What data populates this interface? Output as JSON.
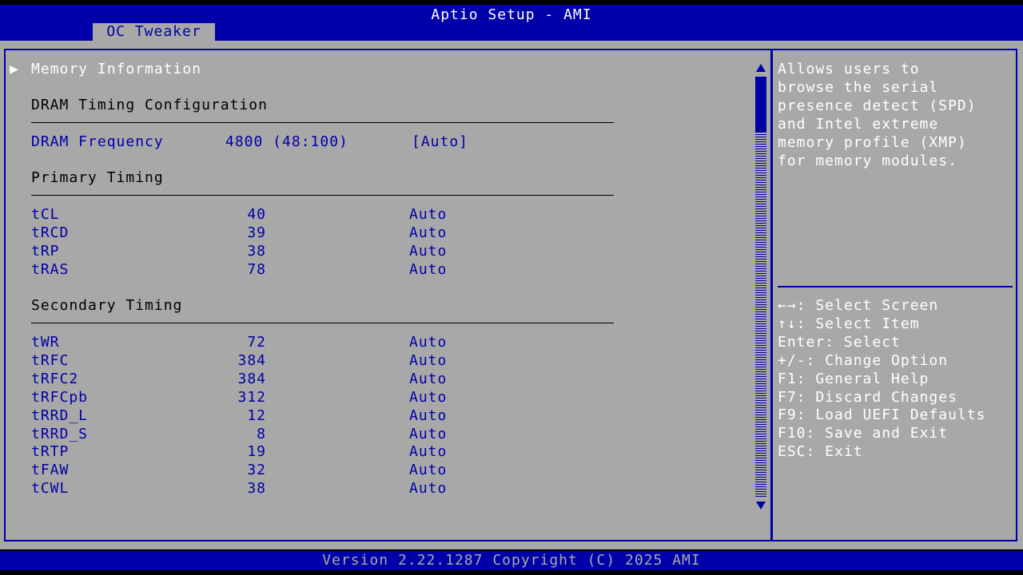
{
  "header": {
    "title": "Aptio Setup - AMI",
    "tab": "OC Tweaker"
  },
  "menu": {
    "memory_info": "Memory Information",
    "dram_section": "DRAM Timing Configuration",
    "dram_freq": {
      "label": "DRAM Frequency",
      "value": "4800 (48:100)",
      "setting": "[Auto]"
    },
    "primary_section": "Primary Timing",
    "primary": [
      {
        "name": "tCL",
        "value": "40",
        "setting": "Auto"
      },
      {
        "name": "tRCD",
        "value": "39",
        "setting": "Auto"
      },
      {
        "name": "tRP",
        "value": "38",
        "setting": "Auto"
      },
      {
        "name": "tRAS",
        "value": "78",
        "setting": "Auto"
      }
    ],
    "secondary_section": "Secondary Timing",
    "secondary": [
      {
        "name": "tWR",
        "value": "72",
        "setting": "Auto"
      },
      {
        "name": "tRFC",
        "value": "384",
        "setting": "Auto"
      },
      {
        "name": "tRFC2",
        "value": "384",
        "setting": "Auto"
      },
      {
        "name": "tRFCpb",
        "value": "312",
        "setting": "Auto"
      },
      {
        "name": "tRRD_L",
        "value": "12",
        "setting": "Auto"
      },
      {
        "name": "tRRD_S",
        "value": "8",
        "setting": "Auto"
      },
      {
        "name": "tRTP",
        "value": "19",
        "setting": "Auto"
      },
      {
        "name": "tFAW",
        "value": "32",
        "setting": "Auto"
      },
      {
        "name": "tCWL",
        "value": "38",
        "setting": "Auto"
      }
    ]
  },
  "help": {
    "description": [
      "Allows users to",
      "browse the serial",
      "presence detect (SPD)",
      "and Intel extreme",
      "memory profile (XMP)",
      "for memory modules."
    ],
    "keys": [
      "←→: Select Screen",
      "↑↓: Select Item",
      "Enter: Select",
      "+/-: Change Option",
      "F1: General Help",
      "F7: Discard Changes",
      "F9: Load UEFI Defaults",
      "F10: Save and Exit",
      "ESC: Exit"
    ]
  },
  "footer": {
    "version": "Version 2.22.1287 Copyright (C) 2025 AMI"
  },
  "colors": {
    "bios_blue": "#0000a8",
    "bios_gray": "#a8a8a8"
  }
}
